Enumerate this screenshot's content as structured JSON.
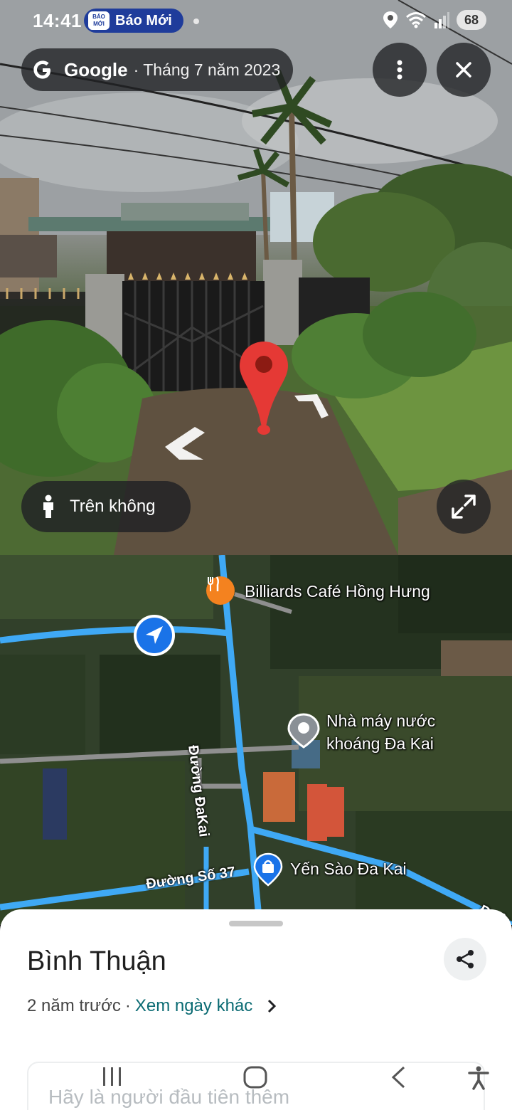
{
  "status_bar": {
    "time": "14:41",
    "news_app_logo_text": "BÁO MỚI",
    "news_app_label": "Báo Mới",
    "battery": "68"
  },
  "street_view": {
    "brand": "Google",
    "date_text": "· Tháng 7 năm 2023",
    "aerial_button_label": "Trên không"
  },
  "map": {
    "poi_billiards": "Billiards Café Hồng Hưng",
    "poi_factory_line1": "Nhà máy nước",
    "poi_factory_line2": "khoáng Đa Kai",
    "poi_nest": "Yến Sào Đa Kai",
    "road_dakai": "Đường ĐaKai",
    "road_37": "Đường Số 37",
    "road_edge": "Đườ"
  },
  "sheet": {
    "title": "Bình Thuận",
    "age": "2 năm trước",
    "separator": "·",
    "other_dates_link": "Xem ngày khác",
    "first_contributor": "Hãy là người đầu tiên thêm"
  },
  "colors": {
    "route_blue": "#3fa9f5",
    "location_blue": "#1a73e8",
    "pin_red": "#e53935",
    "restaurant_orange": "#f4821f",
    "link_teal": "#0b6b73"
  }
}
